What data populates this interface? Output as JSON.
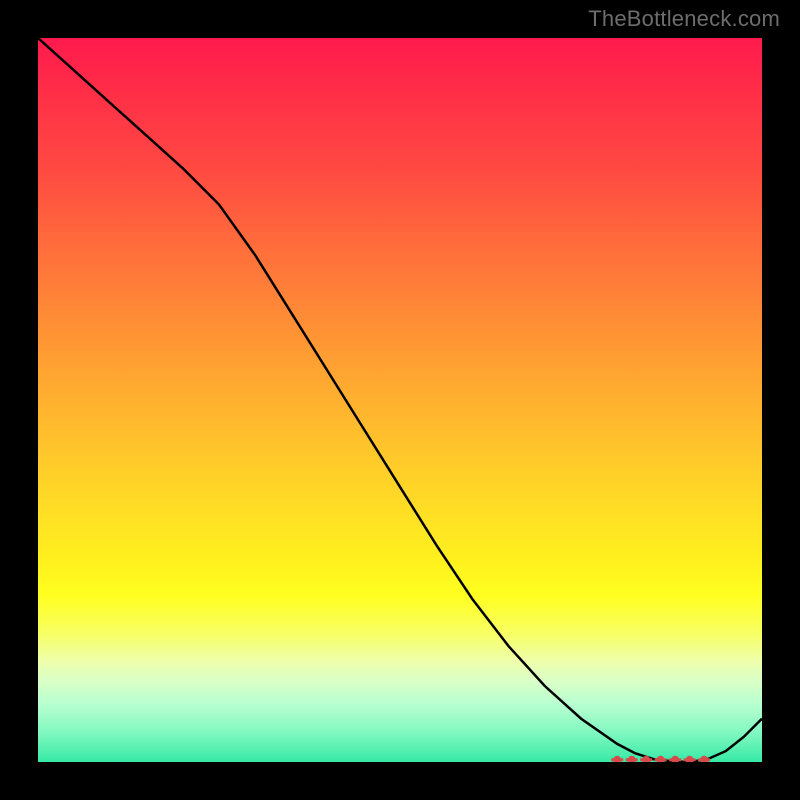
{
  "watermark": "TheBottleneck.com",
  "chart_data": {
    "type": "line",
    "title": "",
    "xlabel": "",
    "ylabel": "",
    "x": [
      0.0,
      0.05,
      0.1,
      0.15,
      0.2,
      0.25,
      0.3,
      0.35,
      0.4,
      0.45,
      0.5,
      0.55,
      0.6,
      0.65,
      0.7,
      0.75,
      0.8,
      0.825,
      0.85,
      0.875,
      0.9,
      0.925,
      0.95,
      0.975,
      1.0
    ],
    "y": [
      1.0,
      0.955,
      0.91,
      0.865,
      0.82,
      0.77,
      0.7,
      0.62,
      0.54,
      0.46,
      0.38,
      0.3,
      0.225,
      0.16,
      0.105,
      0.06,
      0.025,
      0.012,
      0.004,
      0.001,
      0.0,
      0.004,
      0.015,
      0.035,
      0.06
    ],
    "xlim": [
      0,
      1
    ],
    "ylim": [
      0,
      1
    ],
    "bottom_markers_x": [
      0.8,
      0.82,
      0.84,
      0.86,
      0.88,
      0.9,
      0.92
    ]
  },
  "colors": {
    "curve": "#000000",
    "marker": "#d84a4a",
    "background": "#000000"
  }
}
